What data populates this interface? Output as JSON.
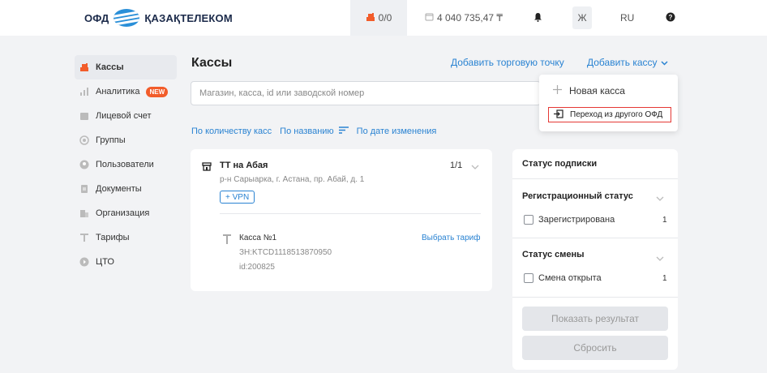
{
  "header": {
    "logo_left": "ОФД",
    "logo_right": "ҚАЗАҚТЕЛЕКОМ",
    "kkm_count": "0/0",
    "balance": "4 040 735,47 ₸",
    "user_initial": "Ж",
    "language": "RU"
  },
  "sidebar": {
    "items": [
      {
        "label": "Кассы"
      },
      {
        "label": "Аналитика",
        "badge": "NEW"
      },
      {
        "label": "Лицевой счет"
      },
      {
        "label": "Группы"
      },
      {
        "label": "Пользователи"
      },
      {
        "label": "Документы"
      },
      {
        "label": "Организация"
      },
      {
        "label": "Тарифы"
      },
      {
        "label": "ЦТО"
      }
    ]
  },
  "main": {
    "title": "Кассы",
    "add_point": "Добавить торговую точку",
    "add_kassa": "Добавить кассу",
    "search_placeholder": "Магазин, касса, id или заводской номер",
    "sort": {
      "by_count": "По количеству касс",
      "by_name": "По названию",
      "by_date": "По дате изменения"
    },
    "point": {
      "name": "ТТ на Абая",
      "address": "р-н Сарыарка, г. Астана, пр. Абай, д. 1",
      "vpn": "+ VPN",
      "counter": "1/1",
      "kassa": {
        "name": "Касса №1",
        "serial": "ЗН:KTCD1118513870950",
        "id": "id:200825",
        "tariff_link": "Выбрать тариф"
      }
    }
  },
  "dropdown": {
    "new_kassa": "Новая касса",
    "transfer": "Переход из другого ОФД"
  },
  "filters": {
    "subscription": "Статус подписки",
    "reg_status": "Регистрационный статус",
    "registered": "Зарегистрирована",
    "registered_count": "1",
    "shift_status": "Статус смены",
    "shift_open": "Смена открыта",
    "shift_open_count": "1",
    "show_result": "Показать результат",
    "reset": "Сбросить"
  },
  "colors": {
    "accent": "#2a83d2",
    "brand_orange": "#f25c2a",
    "highlight_red": "#e53935"
  }
}
